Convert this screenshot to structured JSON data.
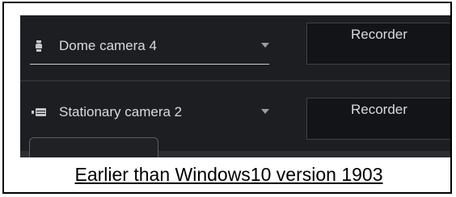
{
  "cameras": [
    {
      "label": "Dome camera 4",
      "icon": "dome-camera-icon",
      "recorder": "Recorder"
    },
    {
      "label": "Stationary camera 2",
      "icon": "stationary-camera-icon",
      "recorder": "Recorder"
    }
  ],
  "caption": "Earlier than Windows10 version 1903",
  "colors": {
    "background": "#1c1e22",
    "text": "#d8dadd",
    "field": "#121417"
  }
}
